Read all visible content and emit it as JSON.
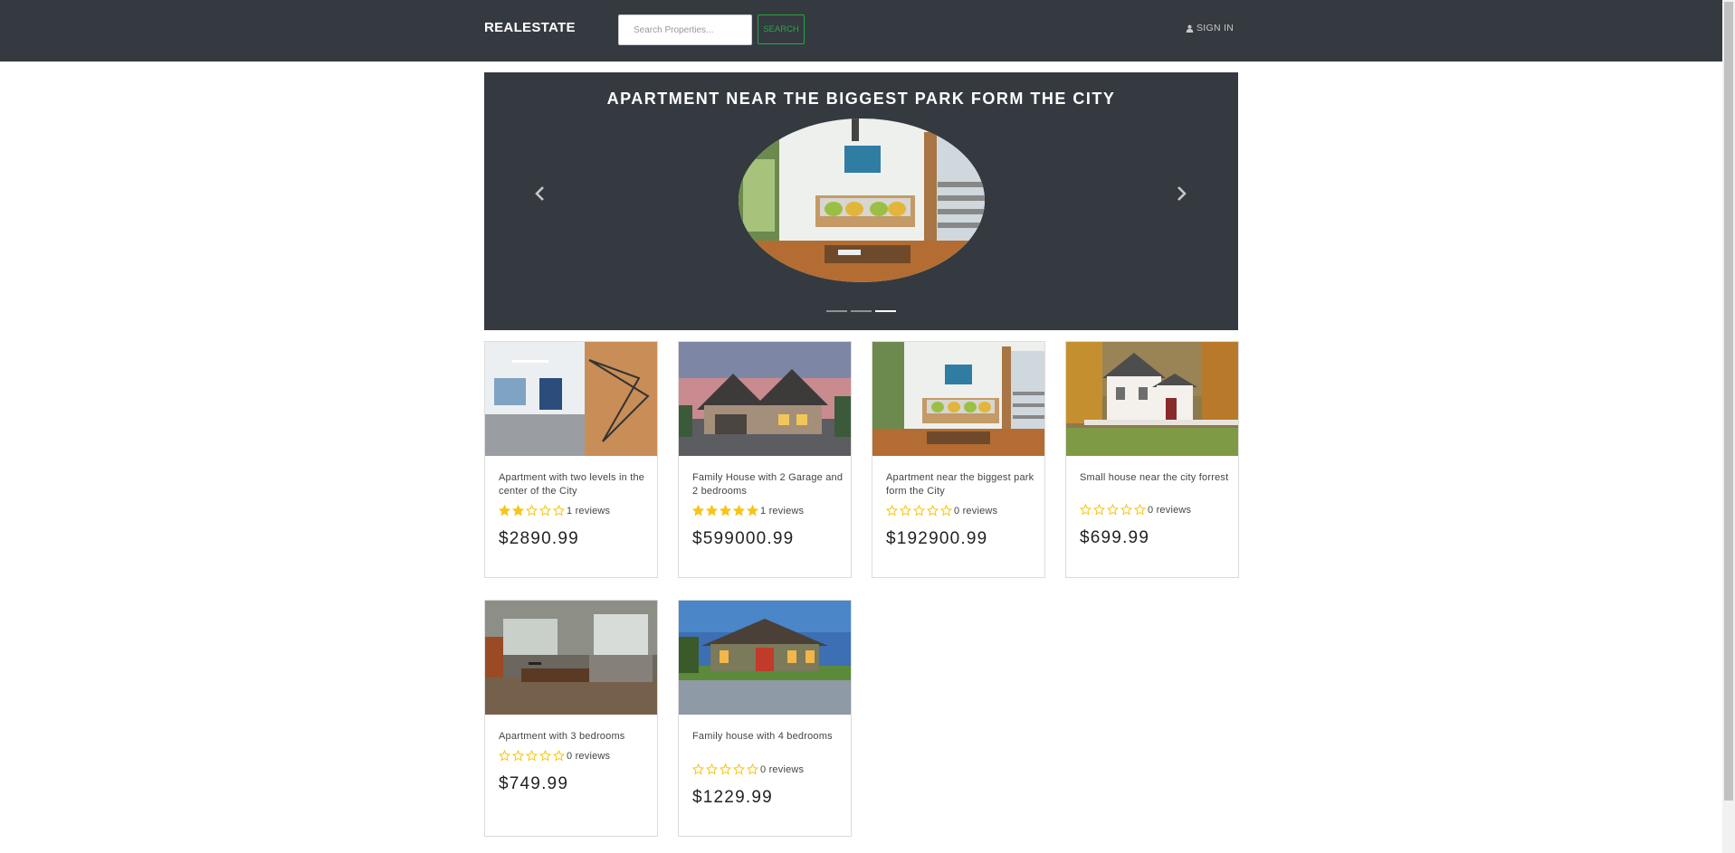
{
  "nav": {
    "brand": "REALESTATE",
    "search_placeholder": "Search Properties...",
    "search_button": "SEARCH",
    "signin": "SIGN IN",
    "signin_icon": "user-icon"
  },
  "carousel": {
    "title": "APARTMENT NEAR THE BIGGEST PARK FORM THE CITY",
    "slide_count": 3,
    "active_slide": 3,
    "prev_icon": "chevron-left-icon",
    "next_icon": "chevron-right-icon"
  },
  "listings": [
    {
      "title": "Apartment with two levels in the center of the City",
      "rating": 2,
      "reviews": "1 reviews",
      "price": "$2890.99"
    },
    {
      "title": "Family House with 2 Garage and 2 bedrooms",
      "rating": 5,
      "reviews": "1 reviews",
      "price": "$599000.99"
    },
    {
      "title": "Apartment near the biggest park form the City",
      "rating": 0,
      "reviews": "0 reviews",
      "price": "$192900.99"
    },
    {
      "title": "Small house near the city forrest",
      "rating": 0,
      "reviews": "0 reviews",
      "price": "$699.99"
    },
    {
      "title": "Apartment with 3 bedrooms",
      "rating": 0,
      "reviews": "0 reviews",
      "price": "$749.99"
    },
    {
      "title": "Family house with 4 bedrooms",
      "rating": 0,
      "reviews": "0 reviews",
      "price": "$1229.99"
    }
  ],
  "colors": {
    "navbar_bg": "#343a40",
    "accent_green": "#28a745",
    "star_color": "#f5c518"
  }
}
